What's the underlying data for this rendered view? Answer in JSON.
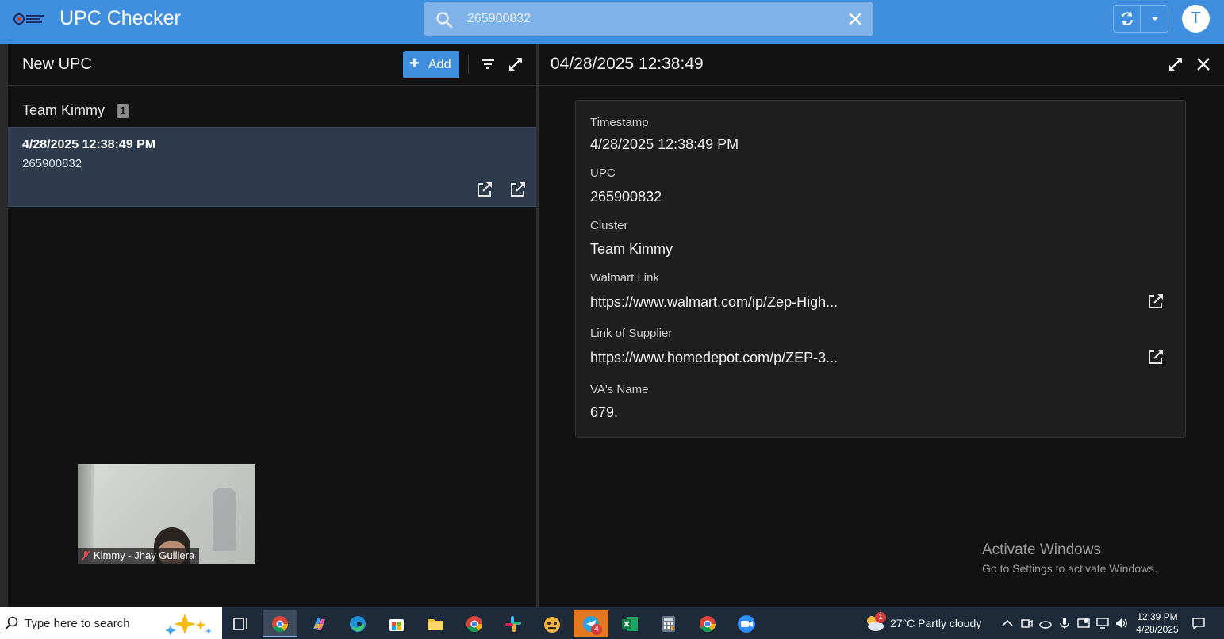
{
  "header": {
    "title": "UPC Checker",
    "search_value": "265900832",
    "avatar_initial": "T"
  },
  "left_panel": {
    "title": "New UPC",
    "add_label": "Add",
    "group": {
      "name": "Team Kimmy",
      "count": "1"
    },
    "items": [
      {
        "timestamp": "4/28/2025 12:38:49 PM",
        "upc": "265900832"
      }
    ]
  },
  "right_panel": {
    "title": "04/28/2025 12:38:49",
    "fields": [
      {
        "label": "Timestamp",
        "value": "4/28/2025 12:38:49 PM"
      },
      {
        "label": "UPC",
        "value": "265900832"
      },
      {
        "label": "Cluster",
        "value": "Team Kimmy"
      },
      {
        "label": "Walmart Link",
        "value": "https://www.walmart.com/ip/Zep-High..."
      },
      {
        "label": "Link of Supplier",
        "value": "https://www.homedepot.com/p/ZEP-3..."
      },
      {
        "label": "VA's Name",
        "value": "679."
      }
    ]
  },
  "video": {
    "participant": "Kimmy - Jhay Guillera"
  },
  "watermark": {
    "line1": "Activate Windows",
    "line2": "Go to Settings to activate Windows."
  },
  "taskbar": {
    "search_placeholder": "Type here to search",
    "weather": "27°C  Partly cloudy",
    "time": "12:39 PM",
    "date": "4/28/2025",
    "telegram_badge": "4",
    "weather_badge": "1"
  },
  "colors": {
    "accent": "#3f8fde",
    "selected_row": "#2d3b4c",
    "background": "#121212",
    "card": "#1f1f1f"
  }
}
